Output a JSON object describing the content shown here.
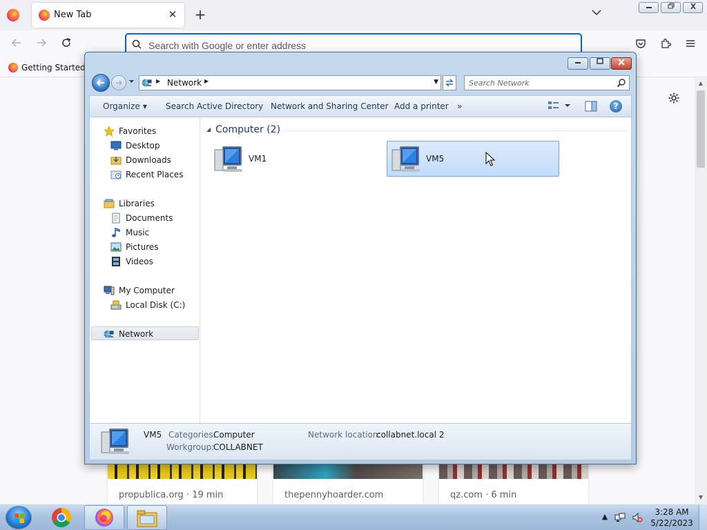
{
  "firefox": {
    "tab_title": "New Tab",
    "tab_close": "✕",
    "new_tab": "+",
    "urlbar_placeholder": "Search with Google or enter address",
    "bookmark": "Getting Started"
  },
  "stories": [
    {
      "source": "propublica.org · 19 min"
    },
    {
      "source": "thepennyhoarder.com"
    },
    {
      "source": "qz.com · 6 min"
    }
  ],
  "explorer": {
    "address_crumb": "Network",
    "search_placeholder": "Search Network",
    "commands": {
      "organize": "Organize",
      "search_ad": "Search Active Directory",
      "network_sharing": "Network and Sharing Center",
      "add_printer": "Add a printer",
      "more": "»"
    },
    "nav": {
      "favorites": "Favorites",
      "desktop": "Desktop",
      "downloads": "Downloads",
      "recent": "Recent Places",
      "libraries": "Libraries",
      "documents": "Documents",
      "music": "Music",
      "pictures": "Pictures",
      "videos": "Videos",
      "my_computer": "My Computer",
      "local_disk": "Local Disk (C:)",
      "network": "Network"
    },
    "group_header": "Computer (2)",
    "items": [
      {
        "name": "VM1",
        "selected": false
      },
      {
        "name": "VM5",
        "selected": true
      }
    ],
    "details": {
      "name": "VM5",
      "categories_label": "Categories:",
      "categories_value": "Computer",
      "workgroup_label": "Workgroup:",
      "workgroup_value": "COLLABNET",
      "location_label": "Network location:",
      "location_value": "collabnet.local  2"
    }
  },
  "taskbar": {
    "time": "3:28 AM",
    "date": "5/22/2023"
  },
  "colors": {
    "accent": "#0061e0",
    "selection": "#c1dcfc",
    "explorer_frame": "#b4cbe5"
  }
}
